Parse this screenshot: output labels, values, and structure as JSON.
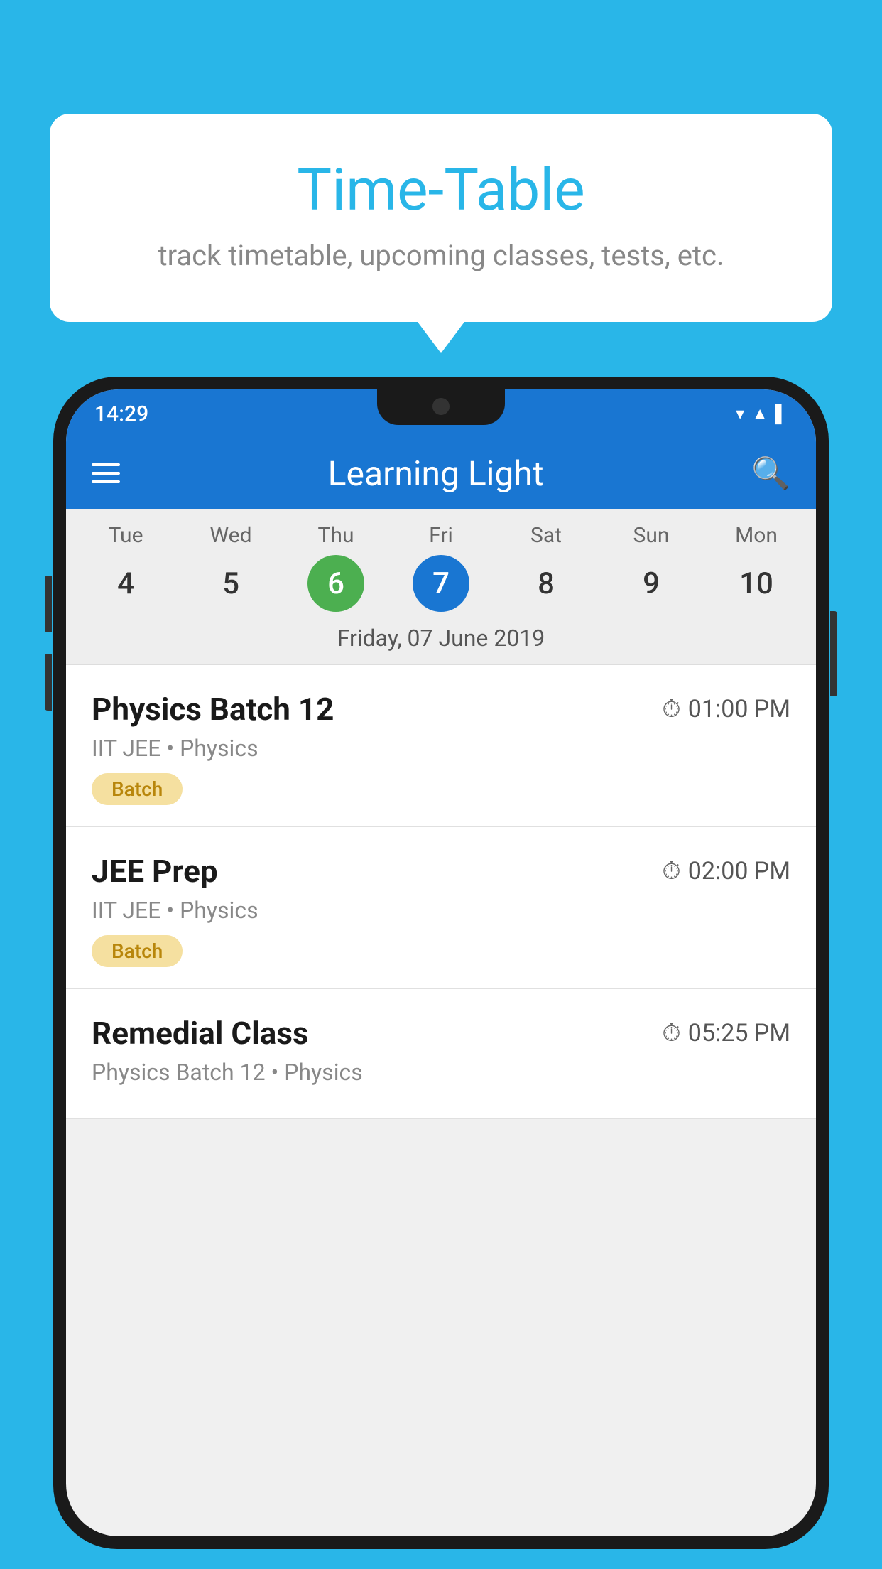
{
  "background_color": "#29b6e8",
  "tooltip": {
    "title": "Time-Table",
    "subtitle": "track timetable, upcoming classes, tests, etc."
  },
  "phone": {
    "status_bar": {
      "time": "14:29",
      "icons": "▾ ▲ ▌"
    },
    "app_bar": {
      "title": "Learning Light",
      "menu_icon": "hamburger",
      "search_icon": "search"
    },
    "calendar": {
      "days": [
        {
          "label": "Tue",
          "num": "4",
          "state": "normal"
        },
        {
          "label": "Wed",
          "num": "5",
          "state": "normal"
        },
        {
          "label": "Thu",
          "num": "6",
          "state": "today"
        },
        {
          "label": "Fri",
          "num": "7",
          "state": "selected"
        },
        {
          "label": "Sat",
          "num": "8",
          "state": "normal"
        },
        {
          "label": "Sun",
          "num": "9",
          "state": "normal"
        },
        {
          "label": "Mon",
          "num": "10",
          "state": "normal"
        }
      ],
      "selected_date_label": "Friday, 07 June 2019"
    },
    "schedule": {
      "items": [
        {
          "name": "Physics Batch 12",
          "time": "01:00 PM",
          "meta": "IIT JEE • Physics",
          "badge": "Batch"
        },
        {
          "name": "JEE Prep",
          "time": "02:00 PM",
          "meta": "IIT JEE • Physics",
          "badge": "Batch"
        },
        {
          "name": "Remedial Class",
          "time": "05:25 PM",
          "meta": "Physics Batch 12 • Physics",
          "badge": null
        }
      ]
    }
  }
}
